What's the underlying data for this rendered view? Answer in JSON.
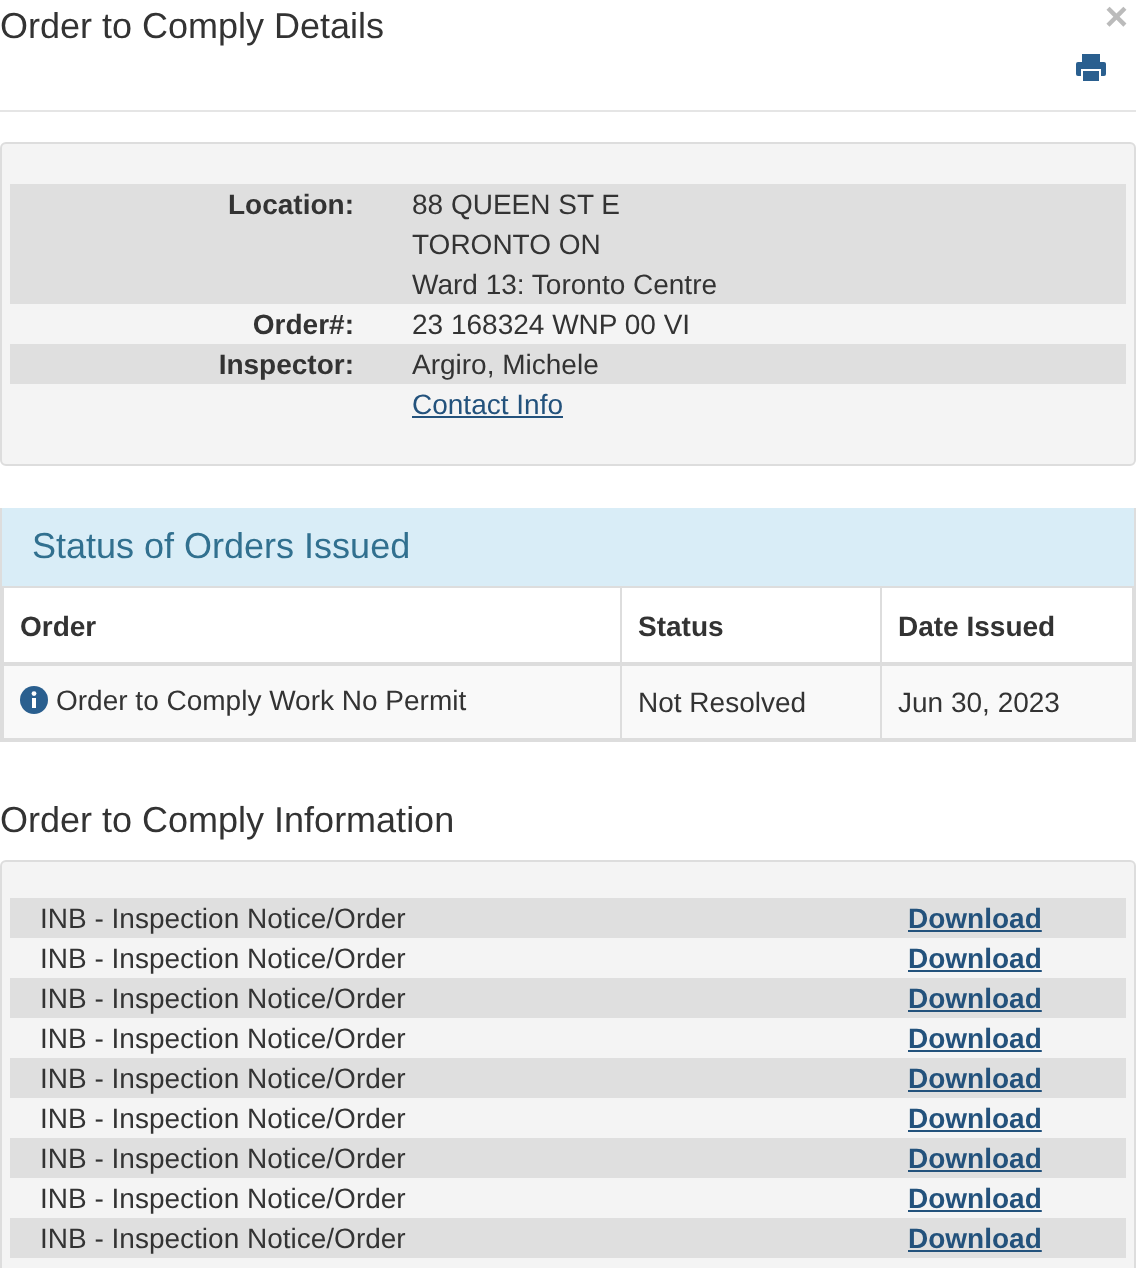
{
  "title": "Order to Comply Details",
  "close": "×",
  "details": [
    {
      "label": "Location:",
      "lines": [
        "88 QUEEN ST E",
        "TORONTO ON",
        "Ward 13: Toronto Centre"
      ]
    },
    {
      "label": "Order#:",
      "lines": [
        "23 168324 WNP 00 VI"
      ]
    },
    {
      "label": "Inspector:",
      "lines": [
        "Argiro, Michele"
      ]
    }
  ],
  "contact_link": "Contact Info",
  "status_panel": {
    "title": "Status of Orders Issued",
    "columns": [
      "Order",
      "Status",
      "Date Issued"
    ],
    "rows": [
      [
        "Order to Comply Work No Permit",
        "Not Resolved",
        "Jun 30, 2023"
      ]
    ]
  },
  "info_heading": "Order to Comply Information",
  "documents": [
    {
      "name": "INB - Inspection Notice/Order",
      "link": "Download"
    },
    {
      "name": "INB - Inspection Notice/Order",
      "link": "Download"
    },
    {
      "name": "INB - Inspection Notice/Order",
      "link": "Download"
    },
    {
      "name": "INB - Inspection Notice/Order",
      "link": "Download"
    },
    {
      "name": "INB - Inspection Notice/Order",
      "link": "Download"
    },
    {
      "name": "INB - Inspection Notice/Order",
      "link": "Download"
    },
    {
      "name": "INB - Inspection Notice/Order",
      "link": "Download"
    },
    {
      "name": "INB - Inspection Notice/Order",
      "link": "Download"
    },
    {
      "name": "INB - Inspection Notice/Order",
      "link": "Download"
    }
  ]
}
